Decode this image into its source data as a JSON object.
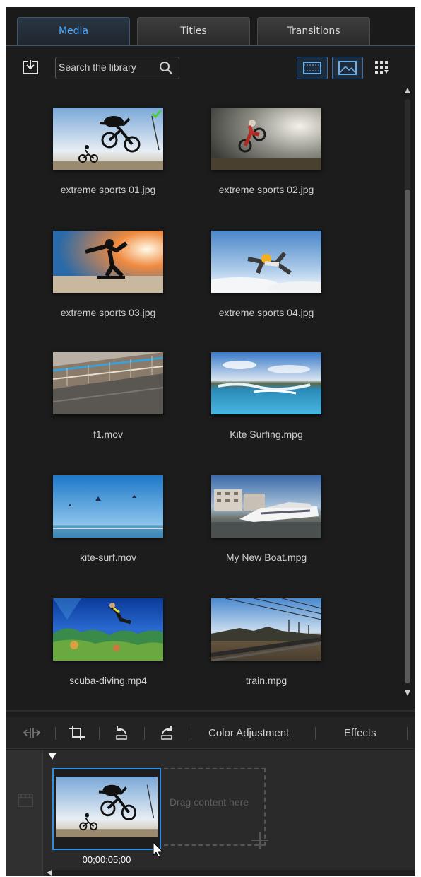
{
  "tabs": [
    {
      "label": "Media",
      "active": true
    },
    {
      "label": "Titles",
      "active": false
    },
    {
      "label": "Transitions",
      "active": false
    }
  ],
  "search": {
    "placeholder": "Search the library"
  },
  "icons": {
    "import": "import-media-icon",
    "search": "search-icon",
    "view_list": "storyboard-view-icon",
    "view_thumb": "thumbnail-view-icon",
    "grid": "grid-size-icon",
    "check": "check-icon",
    "split": "split-icon",
    "crop": "crop-icon",
    "rotate_left": "rotate-left-icon",
    "rotate_right": "rotate-right-icon"
  },
  "library": {
    "items": [
      {
        "label": "extreme sports 01.jpg",
        "selected": true
      },
      {
        "label": "extreme sports 02.jpg",
        "selected": false
      },
      {
        "label": "extreme sports 03.jpg",
        "selected": false
      },
      {
        "label": "extreme sports 04.jpg",
        "selected": false
      },
      {
        "label": "f1.mov",
        "selected": false
      },
      {
        "label": "Kite Surfing.mpg",
        "selected": false
      },
      {
        "label": "kite-surf.mov",
        "selected": false
      },
      {
        "label": "My New Boat.mpg",
        "selected": false
      },
      {
        "label": "scuba-diving.mp4",
        "selected": false
      },
      {
        "label": "train.mpg",
        "selected": false
      }
    ]
  },
  "edit_toolbar": {
    "color_adjustment": "Color Adjustment",
    "effects": "Effects"
  },
  "timeline": {
    "clip_time": "00;00;05;00",
    "drop_hint": "Drag content here"
  },
  "colors": {
    "accent": "#2d8fe6",
    "active_tab_text": "#4aa8ff",
    "background": "#1c1c1c"
  }
}
